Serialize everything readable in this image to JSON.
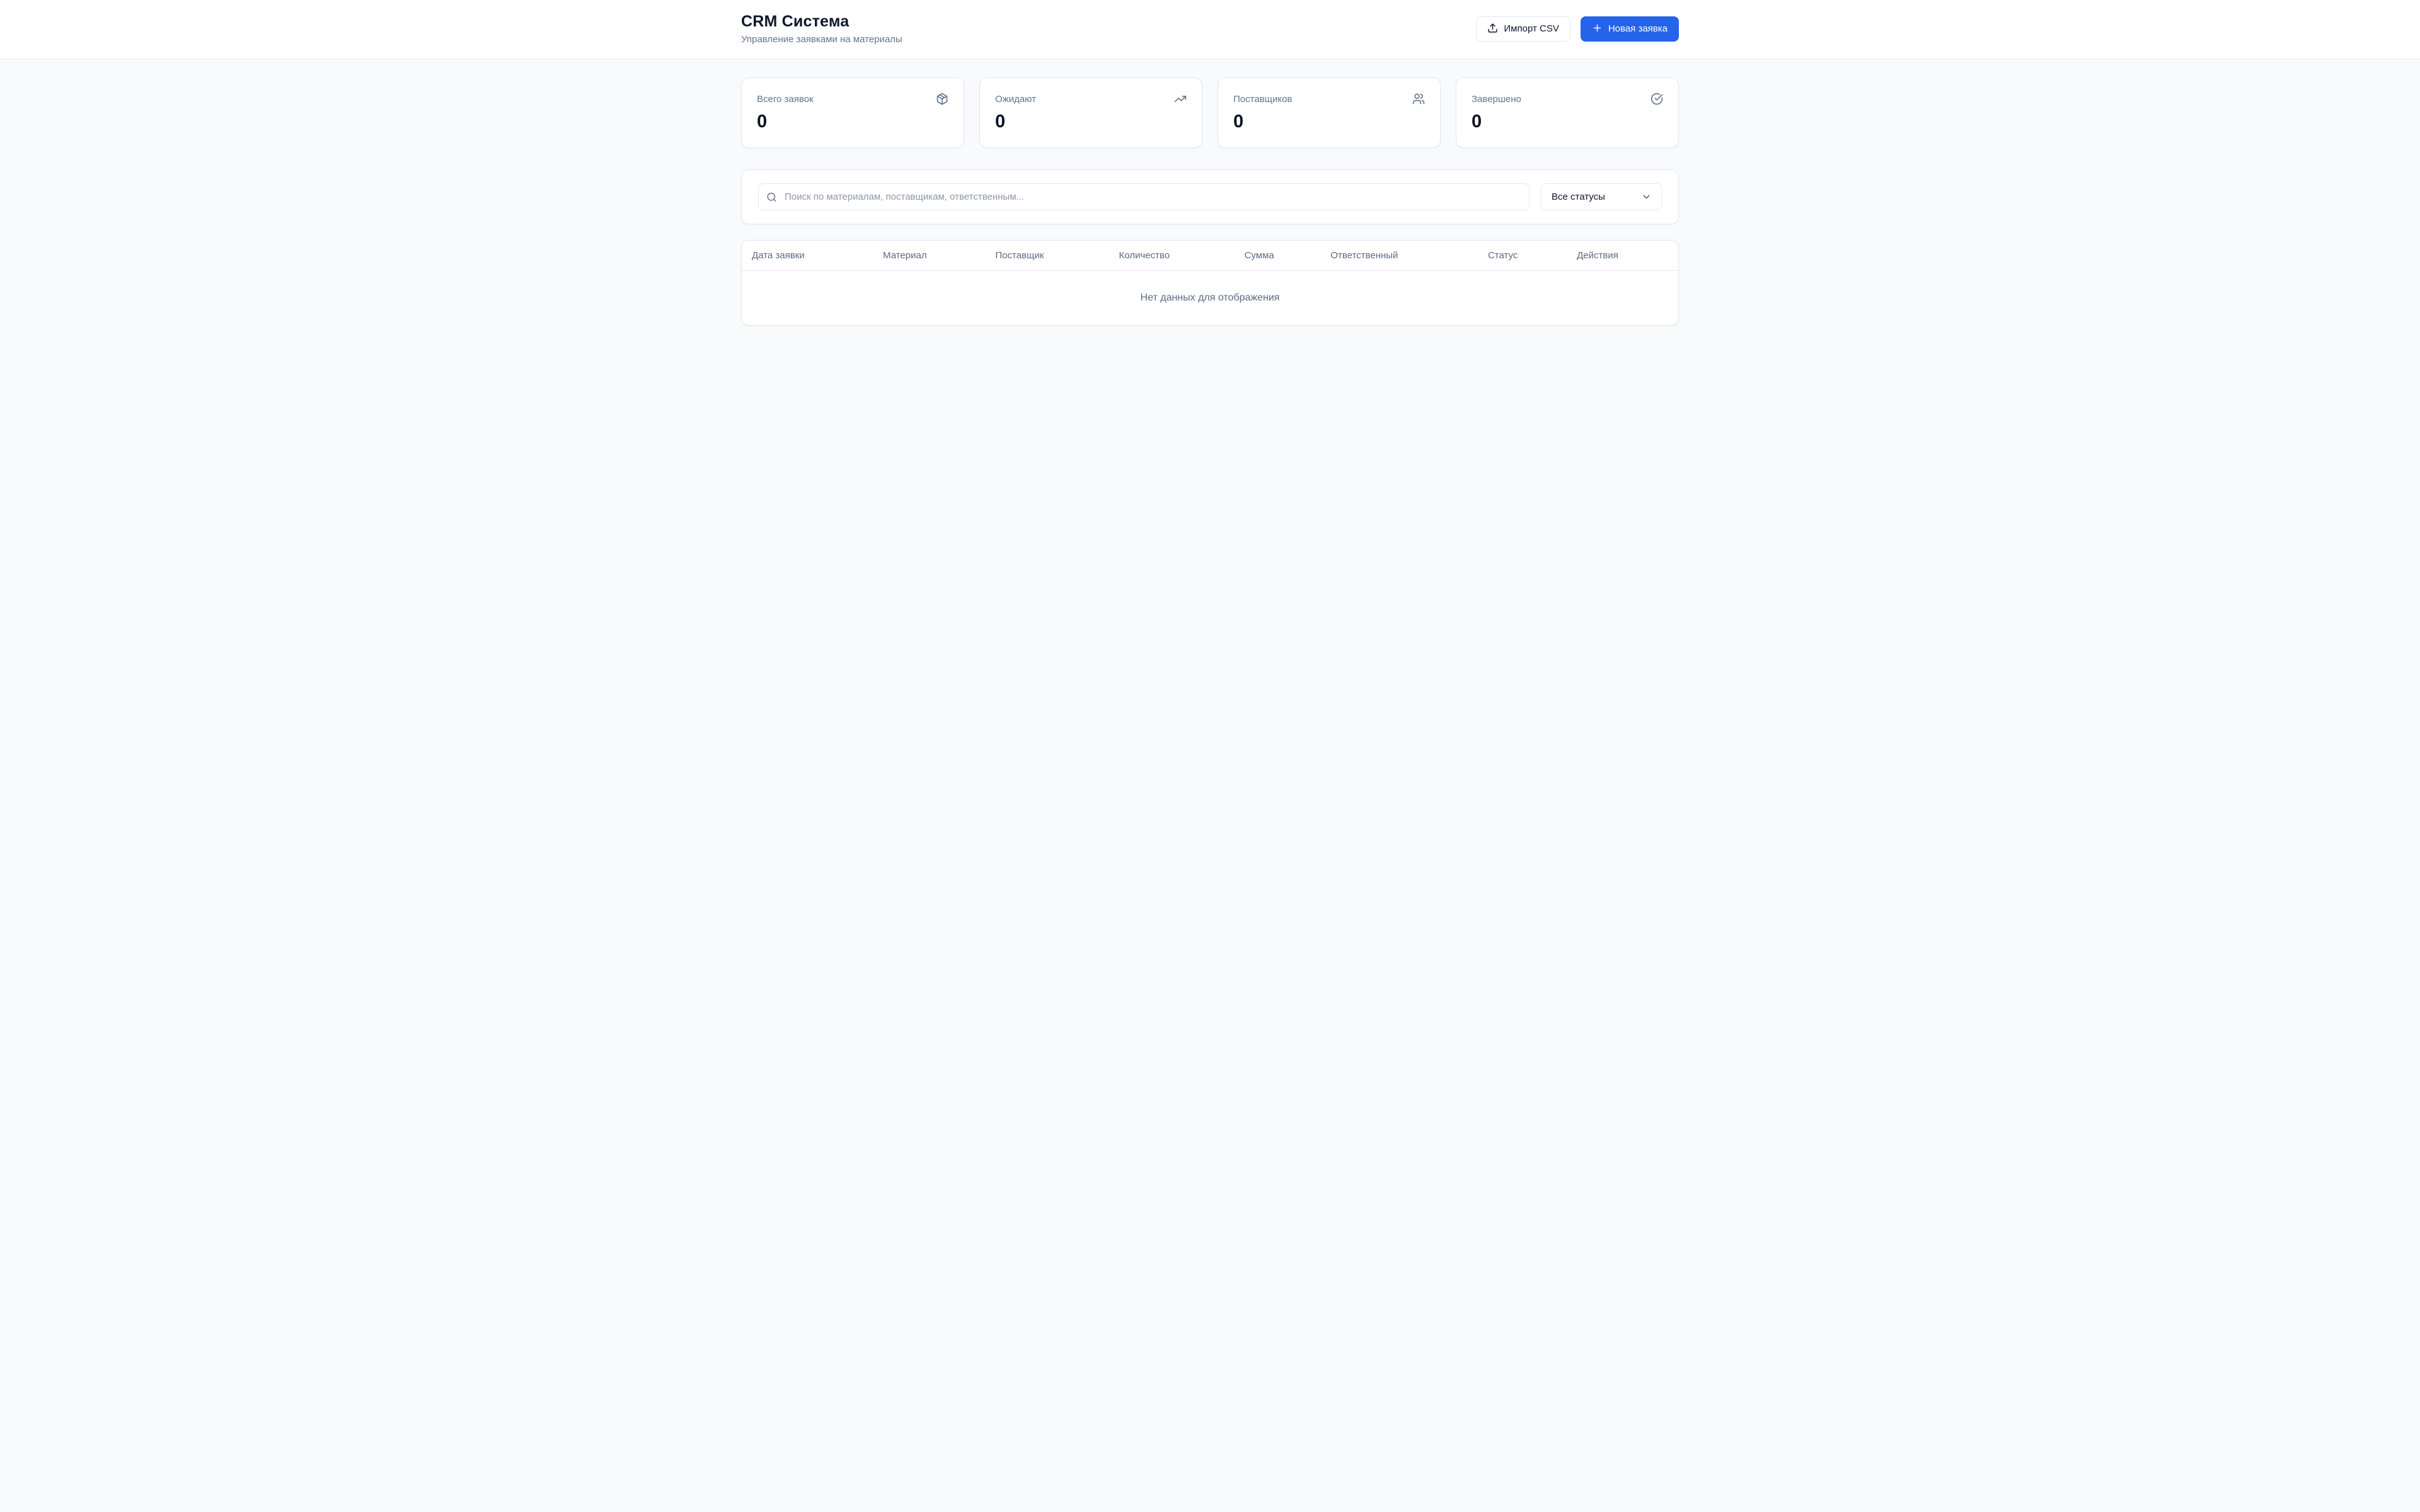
{
  "header": {
    "title": "CRM Система",
    "subtitle": "Управление заявками на материалы",
    "import_button": "Импорт CSV",
    "new_request_button": "Новая заявка"
  },
  "stats": {
    "cards": [
      {
        "label": "Всего заявок",
        "value": "0",
        "icon": "package-icon"
      },
      {
        "label": "Ожидают",
        "value": "0",
        "icon": "trending-up-icon"
      },
      {
        "label": "Поставщиков",
        "value": "0",
        "icon": "users-icon"
      },
      {
        "label": "Завершено",
        "value": "0",
        "icon": "circle-check-icon"
      }
    ]
  },
  "filters": {
    "search_placeholder": "Поиск по материалам, поставщикам, ответственным...",
    "status_filter_value": "Все статусы"
  },
  "table": {
    "columns": [
      "Дата заявки",
      "Материал",
      "Поставщик",
      "Количество",
      "Сумма",
      "Ответственный",
      "Статус",
      "Действия"
    ],
    "rows": [],
    "empty_message": "Нет данных для отображения"
  },
  "colors": {
    "accent": "#2563eb",
    "page_background": "#f8fafc",
    "card_border": "#e2e8f0",
    "muted_text": "#64748b"
  }
}
